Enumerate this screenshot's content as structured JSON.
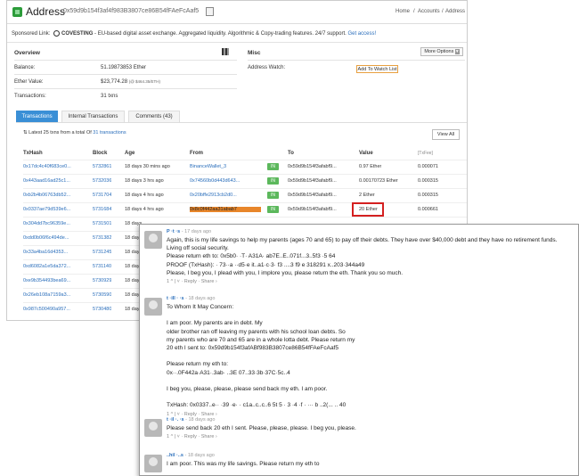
{
  "header": {
    "title": "Address",
    "address": "0x59d9b154f3af4f983B3807ce86B54fFAeFcAaf5",
    "nav": [
      "Home",
      "Accounts",
      "Address"
    ]
  },
  "sponsor": {
    "label": "Sponsored Link:",
    "name": "COVESTING",
    "text": " - EU-based digital asset exchange. Aggregated liquidity. Algorithmic & Copy-trading features. 24/7 support.",
    "link": "Get access!"
  },
  "overview": {
    "title": "Overview",
    "rows": [
      {
        "label": "Balance:",
        "value": "51.19873853 Ether"
      },
      {
        "label": "Ether Value:",
        "value": "$23,774.28",
        "extra": "(@ $464.35/ETH)"
      },
      {
        "label": "Transactions:",
        "value": "31 txns"
      }
    ]
  },
  "misc": {
    "title": "Misc",
    "options_btn": "More Options",
    "watch_label": "Address Watch:",
    "watch_btn": "Add To Watch List"
  },
  "tabs": [
    {
      "label": "Transactions",
      "active": true
    },
    {
      "label": "Internal Transactions",
      "active": false
    },
    {
      "label": "Comments (43)",
      "active": false
    }
  ],
  "latest": {
    "prefix": "Latest 25 txns from a total Of ",
    "link": "31 transactions"
  },
  "view_all": "View All",
  "columns": [
    "TxHash",
    "Block",
    "Age",
    "From",
    "",
    "To",
    "Value",
    "[TxFee]"
  ],
  "transactions": [
    {
      "hash": "0x17dc4c40f683ce0...",
      "block": "5732861",
      "age": "18 days 30 mins ago",
      "from": "BinanceWallet_3",
      "to": "0x59d9b154f3afabf9...",
      "value": "0.97 Ether",
      "fee": "0.000071"
    },
    {
      "hash": "0x443aad16ad25c1...",
      "block": "5732036",
      "age": "18 days 3 hrs ago",
      "from": "0x74560b0d443d643...",
      "to": "0x59d9b154f3afabf9...",
      "value": "0.00170723 Ether",
      "fee": "0.000315"
    },
    {
      "hash": "0xb2b4b06763db52...",
      "block": "5731704",
      "age": "18 days 4 hrs ago",
      "from": "0x20bffe2913cb2d0...",
      "to": "0x59d9b154f3afabf9...",
      "value": "2 Ether",
      "fee": "0.000315"
    },
    {
      "hash": "0x0337ae79d539e6...",
      "block": "5731684",
      "age": "18 days 4 hrs ago",
      "from": "0x8c0f442aa31abab7",
      "to": "0x59d9b154f3afabf9...",
      "value": "20 Ether",
      "fee": "0.000661"
    },
    {
      "hash": "0x304dd7bc96359e...",
      "block": "5731501",
      "age": "18 days",
      "from": "",
      "to": "",
      "value": "",
      "fee": ""
    },
    {
      "hash": "0xdd0b06f6c494de...",
      "block": "5731382",
      "age": "18 days",
      "from": "",
      "to": "",
      "value": "",
      "fee": ""
    },
    {
      "hash": "0x33a4ba16d4353...",
      "block": "5731245",
      "age": "18 days",
      "from": "",
      "to": "",
      "value": "",
      "fee": ""
    },
    {
      "hash": "0xd6082a1e5da372...",
      "block": "5731140",
      "age": "18 days",
      "from": "",
      "to": "",
      "value": "",
      "fee": ""
    },
    {
      "hash": "0xe9b354493bea69...",
      "block": "5730929",
      "age": "18 days",
      "from": "",
      "to": "",
      "value": "",
      "fee": ""
    },
    {
      "hash": "0x26eb108a7159a3...",
      "block": "5730590",
      "age": "18 days",
      "from": "",
      "to": "",
      "value": "",
      "fee": ""
    },
    {
      "hash": "0x987c500490a957...",
      "block": "5730480",
      "age": "18 days",
      "from": "",
      "to": "",
      "value": "",
      "fee": ""
    }
  ],
  "comments": [
    {
      "name": "P  ·t  ·s",
      "time": " - 17 days ago",
      "lines": [
        "Again, this is my life savings to help my parents (ages 70 and 65) to pay off their debts. They have over $40,000 debt and they have no retirement funds.",
        "Living off social security.",
        "Please return eth to:  0x5b0· ·T·  A31A· ab7E..E..071f...3..5f3  ·5  64",
        "PROOF (TxHash):  · 73··a  ··d5·e   it..a1·c·3· f3  ....3  f9  e  318291   x..203·344a49",
        "Please, I beg you, I plead with you, I implore you, please return the eth. Thank you so much."
      ],
      "foot": "1 ^  |  ˅  · Reply · Share ›"
    },
    {
      "name": "t  ·ill  ·  ·s",
      "time": " - 18 days ago",
      "lines": [
        "To Whom It May Concern:",
        "",
        "I am poor. My parents are in debt. My",
        "older brother ran off leaving my parents with his school loan debts. So",
        "my parents who are 70 and 65 are in a whole lotta debt. Please return my",
        "20 eth I sent to: 0x59d9b154f3afABf983B3807ce86B54fFAeFcAaf5",
        "",
        "Please return my eth to:",
        "0x··.0F442a·A31·.3ab· ..3E 07..33·3b·37C·5c..4",
        "",
        "I beg you, please, please, please send back my eth. I am poor.",
        "",
        "TxHash: 0x0337..e·· ·39  ·e· ·  c1a..c..c..6  5t   5  · 3  ·4  ·f  ·  ··· b  ..2(...  ..   40"
      ],
      "foot": "1 ^  |  ˅  · Reply · Share ›"
    },
    {
      "name": "t  ·il  ·.  ·s",
      "time": " - 18 days ago",
      "lines": [
        "Please send back 20 eth I sent. Please, please, please. I beg you, please."
      ],
      "foot": "1 ^  |  ˅  · Reply · Share ›"
    },
    {
      "name": "..hil ·..s",
      "time": " - 18 days ago",
      "lines": [
        "I am poor. This was my life savings. Please return my eth to"
      ],
      "foot": ""
    }
  ],
  "colors": {
    "link": "#2a6ebb",
    "tab_active": "#3a8fd6",
    "in_badge": "#5cb85c",
    "highlight": "#e8862a",
    "red_box": "#d42020"
  }
}
